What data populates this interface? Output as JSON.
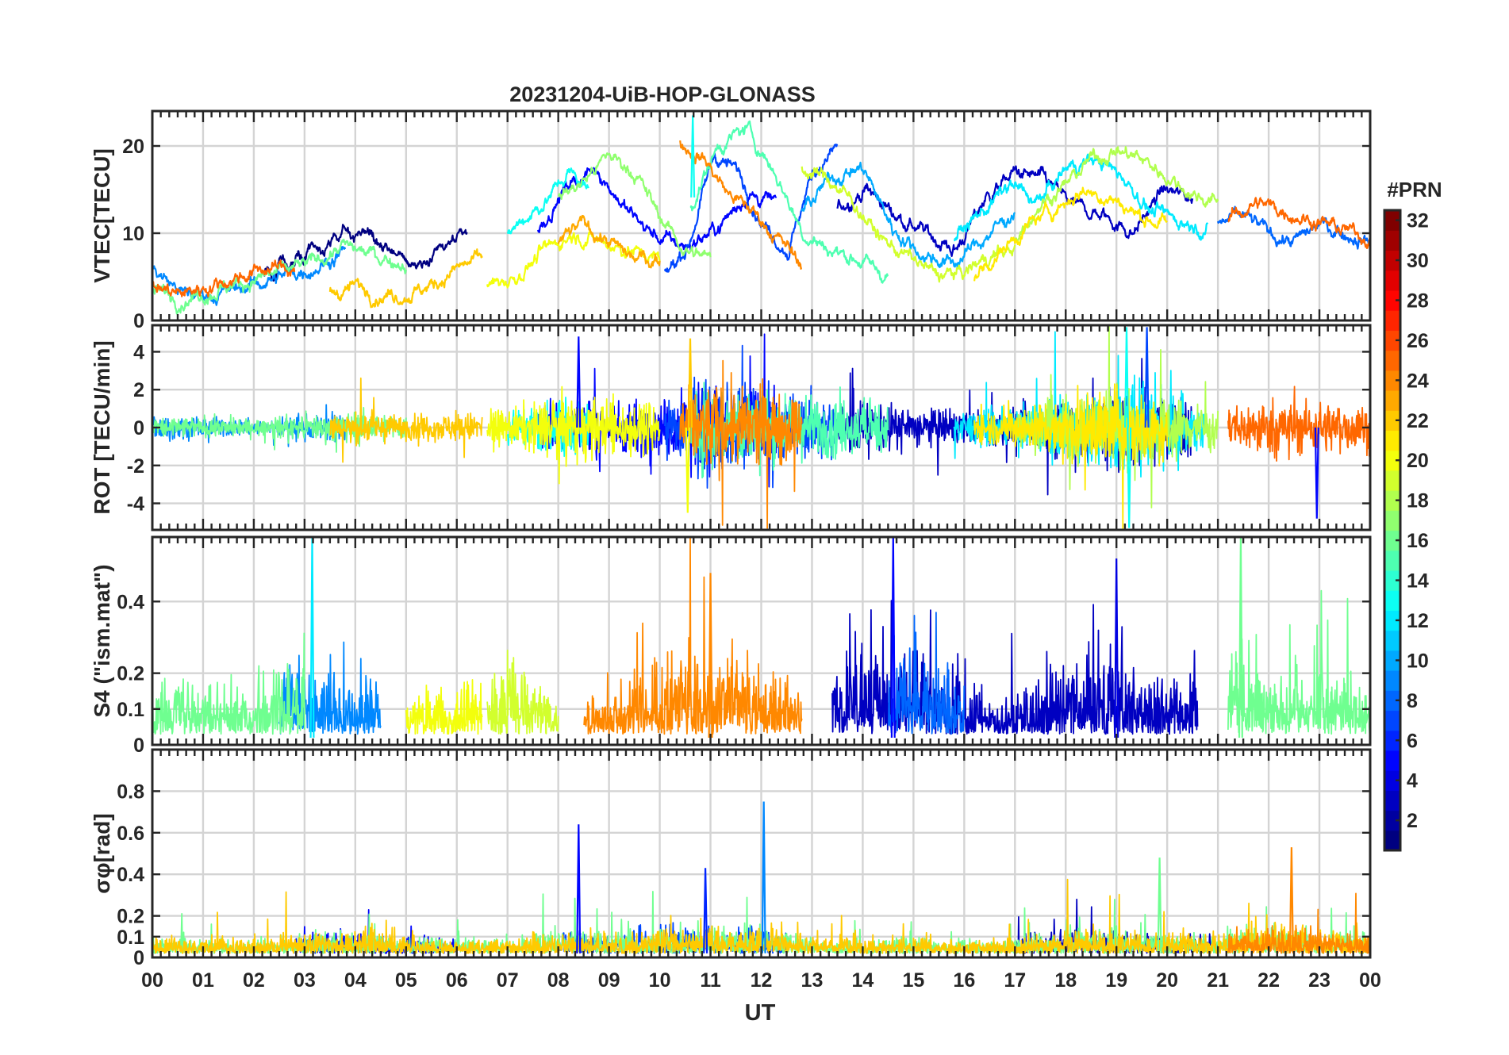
{
  "chart_data": {
    "type": "line",
    "title": "20231204-UiB-HOP-GLONASS",
    "xlabel": "UT",
    "x_ticks": [
      "00",
      "01",
      "02",
      "03",
      "04",
      "05",
      "06",
      "07",
      "08",
      "09",
      "10",
      "11",
      "12",
      "13",
      "14",
      "15",
      "16",
      "17",
      "18",
      "19",
      "20",
      "21",
      "22",
      "23",
      "00"
    ],
    "xlim": [
      0,
      24
    ],
    "grid": true,
    "colorbar": {
      "label": "#PRN",
      "range": [
        1,
        32
      ],
      "ticks": [
        "2",
        "4",
        "6",
        "8",
        "10",
        "12",
        "14",
        "16",
        "18",
        "20",
        "22",
        "24",
        "26",
        "28",
        "30",
        "32"
      ],
      "colormap": "jet",
      "placement": "right"
    },
    "panels": [
      {
        "id": "vtec",
        "ylabel": "VTEC[TECU]",
        "ylim": [
          0,
          24
        ],
        "yticks": [
          {
            "v": 0,
            "label": "0"
          },
          {
            "v": 10,
            "label": "10"
          },
          {
            "v": 20,
            "label": "20"
          }
        ],
        "envelope": {
          "hours": [
            0,
            1,
            2,
            3,
            4,
            5,
            6,
            7,
            8,
            9,
            10,
            11,
            12,
            13,
            14,
            15,
            16,
            17,
            18,
            19,
            20,
            21,
            22,
            23,
            24
          ],
          "mean": [
            4,
            4.5,
            5,
            6.5,
            6,
            6.5,
            8,
            9.5,
            12,
            13,
            12,
            15,
            13,
            12,
            10,
            9,
            10,
            11,
            12,
            14,
            12,
            10.5,
            10,
            9.5,
            9
          ]
        },
        "series": [
          {
            "prn": 1,
            "t0": 2.2,
            "t1": 6.2,
            "offset": 0.5,
            "values": [
              5,
              6,
              7,
              9,
              10,
              7,
              6,
              8,
              9
            ]
          },
          {
            "prn": 3,
            "t0": 13.5,
            "t1": 20.5,
            "offset": 1.0,
            "values": [
              12,
              14,
              11,
              9,
              7,
              13,
              16,
              15,
              12,
              11,
              9,
              14,
              13
            ]
          },
          {
            "prn": 5,
            "t0": 7.6,
            "t1": 12.3,
            "offset": 0.5,
            "values": [
              10,
              15,
              17,
              12,
              9,
              8,
              10,
              14,
              13
            ]
          },
          {
            "prn": 7,
            "t0": 10.1,
            "t1": 13.5,
            "offset": 2.0,
            "values": [
              3,
              7,
              17,
              15,
              9,
              6,
              15,
              18
            ]
          },
          {
            "prn": 8,
            "t0": 21.0,
            "t1": 24.0,
            "offset": 0.0,
            "values": [
              11,
              12,
              10,
              9,
              11,
              10,
              9
            ]
          },
          {
            "prn": 9,
            "t0": 0.0,
            "t1": 3.8,
            "offset": 0.0,
            "values": [
              6,
              3,
              3,
              4,
              5,
              6,
              8
            ]
          },
          {
            "prn": 10,
            "t0": 12.8,
            "t1": 17.0,
            "offset": 0.5,
            "values": [
              12,
              16,
              17,
              10,
              7,
              6,
              9,
              12
            ]
          },
          {
            "prn": 12,
            "t0": 15.8,
            "t1": 20.8,
            "offset": 0.5,
            "values": [
              9,
              12,
              15,
              13,
              17,
              18,
              16,
              12,
              11,
              10
            ]
          },
          {
            "prn": 13,
            "t0": 7.0,
            "t1": 8.6,
            "offset": 0.0,
            "values": [
              10,
              12,
              14,
              17,
              15
            ]
          },
          {
            "prn": 15,
            "t0": 10.6,
            "t1": 14.5,
            "offset": 0.0,
            "values": [
              13,
              20,
              22,
              17,
              10,
              8,
              7,
              5
            ]
          },
          {
            "prn": 16,
            "t0": 0.0,
            "t1": 5.0,
            "offset": 0.5,
            "values": [
              3,
              2,
              3,
              4,
              5,
              6,
              8,
              7,
              6
            ]
          },
          {
            "prn": 17,
            "t0": 8.0,
            "t1": 11.0,
            "offset": 0.0,
            "values": [
              14,
              16,
              19,
              17,
              12,
              8,
              7
            ]
          },
          {
            "prn": 18,
            "t0": 17.0,
            "t1": 21.0,
            "offset": 0.5,
            "values": [
              9,
              13,
              15,
              18,
              19,
              18,
              16,
              14,
              13
            ]
          },
          {
            "prn": 19,
            "t0": 12.8,
            "t1": 17.0,
            "offset": 0.3,
            "values": [
              17,
              16,
              13,
              9,
              7,
              5,
              5,
              7,
              8
            ]
          },
          {
            "prn": 20,
            "t0": 6.6,
            "t1": 10.0,
            "offset": 0.0,
            "values": [
              4,
              5,
              8,
              10,
              9,
              8,
              7
            ]
          },
          {
            "prn": 21,
            "t0": 16.2,
            "t1": 20.0,
            "offset": 0.0,
            "values": [
              5,
              8,
              11,
              13,
              15,
              14,
              12,
              11
            ]
          },
          {
            "prn": 22,
            "t0": 3.5,
            "t1": 6.5,
            "offset": 0.0,
            "values": [
              3,
              4,
              3,
              3,
              4,
              6,
              7
            ]
          },
          {
            "prn": 23,
            "t0": 8.0,
            "t1": 10.0,
            "offset": 0.0,
            "values": [
              9,
              11,
              9,
              7,
              7
            ]
          },
          {
            "prn": 24,
            "t0": 10.4,
            "t1": 12.8,
            "offset": 0.5,
            "values": [
              20,
              18,
              14,
              12,
              9,
              6
            ]
          },
          {
            "prn": 25,
            "t0": 21.2,
            "t1": 24.0,
            "offset": 0.5,
            "values": [
              11,
              13,
              12,
              11,
              10,
              9
            ]
          },
          {
            "prn": 25,
            "t0": 0.0,
            "t1": 2.8,
            "offset": 0.0,
            "values": [
              4,
              3,
              4,
              5,
              6,
              6
            ]
          }
        ]
      },
      {
        "id": "rot",
        "ylabel": "ROT [TECU/min]",
        "ylim": [
          -5.4,
          5.4
        ],
        "yticks": [
          {
            "v": -4,
            "label": "-4"
          },
          {
            "v": -2,
            "label": "-2"
          },
          {
            "v": 0,
            "label": "0"
          },
          {
            "v": 2,
            "label": "2"
          },
          {
            "v": 4,
            "label": "4"
          }
        ],
        "envelope": {
          "hours": [
            0,
            1,
            2,
            3,
            4,
            5,
            6,
            7,
            8,
            9,
            10,
            11,
            12,
            13,
            14,
            15,
            16,
            17,
            18,
            19,
            20,
            21,
            22,
            23,
            24
          ],
          "amplitude": [
            0.6,
            0.5,
            0.4,
            0.6,
            0.8,
            0.6,
            0.7,
            0.9,
            1.5,
            1.4,
            1.3,
            2.2,
            1.8,
            1.6,
            1.3,
            1.0,
            0.8,
            0.9,
            1.6,
            2.2,
            1.6,
            1.0,
            1.4,
            1.3,
            1.1
          ]
        },
        "series": [
          {
            "prn": 3,
            "t0": 13.5,
            "t1": 20.5,
            "offset": 0,
            "values": []
          },
          {
            "prn": 5,
            "t0": 7.6,
            "t1": 12.3,
            "offset": 0,
            "values": []
          },
          {
            "prn": 7,
            "t0": 10.1,
            "t1": 13.5,
            "offset": 0,
            "values": []
          },
          {
            "prn": 9,
            "t0": 0.0,
            "t1": 3.8,
            "offset": 0,
            "values": []
          },
          {
            "prn": 12,
            "t0": 15.8,
            "t1": 20.8,
            "offset": 0,
            "values": []
          },
          {
            "prn": 13,
            "t0": 7.0,
            "t1": 8.6,
            "offset": 0,
            "values": []
          },
          {
            "prn": 15,
            "t0": 10.6,
            "t1": 14.5,
            "offset": 0,
            "values": []
          },
          {
            "prn": 16,
            "t0": 0.0,
            "t1": 5.0,
            "offset": 0,
            "values": []
          },
          {
            "prn": 18,
            "t0": 17.0,
            "t1": 21.0,
            "offset": 0,
            "values": []
          },
          {
            "prn": 20,
            "t0": 6.6,
            "t1": 10.0,
            "offset": 0,
            "values": []
          },
          {
            "prn": 21,
            "t0": 16.2,
            "t1": 20.0,
            "offset": 0,
            "values": []
          },
          {
            "prn": 22,
            "t0": 3.5,
            "t1": 6.5,
            "offset": 0,
            "values": []
          },
          {
            "prn": 24,
            "t0": 10.4,
            "t1": 12.8,
            "offset": 0,
            "values": []
          },
          {
            "prn": 25,
            "t0": 21.2,
            "t1": 24.0,
            "offset": 0,
            "values": []
          }
        ]
      },
      {
        "id": "s4",
        "ylabel": "S4 (\"ism.mat\")",
        "ylim": [
          0,
          0.58
        ],
        "yticks": [
          {
            "v": 0,
            "label": "0"
          },
          {
            "v": 0.1,
            "label": "0.1"
          },
          {
            "v": 0.2,
            "label": "0.2"
          },
          {
            "v": 0.4,
            "label": "0.4"
          }
        ],
        "envelope": {
          "hours": [
            0,
            1,
            2,
            3,
            4,
            5,
            6,
            7,
            8,
            9,
            10,
            11,
            12,
            13,
            14,
            15,
            16,
            17,
            18,
            19,
            20,
            21,
            22,
            23,
            24
          ],
          "mean": [
            0.12,
            0.14,
            0.13,
            0.2,
            0.13,
            0.12,
            0.1,
            0.2,
            0.1,
            0.12,
            0.18,
            0.22,
            0.18,
            0.1,
            0.2,
            0.22,
            0.13,
            0.1,
            0.18,
            0.2,
            0.12,
            0.22,
            0.15,
            0.2,
            0.1
          ]
        },
        "series": [
          {
            "prn": 3,
            "t0": 13.4,
            "t1": 20.6,
            "offset": 0,
            "values": []
          },
          {
            "prn": 9,
            "t0": 2.5,
            "t1": 4.5,
            "offset": 0,
            "values": []
          },
          {
            "prn": 16,
            "t0": 0.0,
            "t1": 3.0,
            "offset": 0,
            "values": []
          },
          {
            "prn": 16,
            "t0": 21.2,
            "t1": 24.0,
            "offset": 0,
            "values": []
          },
          {
            "prn": 19,
            "t0": 6.6,
            "t1": 8.0,
            "offset": 0,
            "values": []
          },
          {
            "prn": 20,
            "t0": 5.0,
            "t1": 6.5,
            "offset": 0,
            "values": []
          },
          {
            "prn": 24,
            "t0": 8.5,
            "t1": 12.8,
            "offset": 0,
            "values": []
          },
          {
            "prn": 8,
            "t0": 14.5,
            "t1": 16.0,
            "offset": 0,
            "values": []
          }
        ]
      },
      {
        "id": "sigma",
        "ylabel": "σφ[rad]",
        "ylim": [
          0,
          1.0
        ],
        "yticks": [
          {
            "v": 0,
            "label": "0"
          },
          {
            "v": 0.1,
            "label": "0.1"
          },
          {
            "v": 0.2,
            "label": "0.2"
          },
          {
            "v": 0.4,
            "label": "0.4"
          },
          {
            "v": 0.6,
            "label": "0.6"
          },
          {
            "v": 0.8,
            "label": "0.8"
          }
        ],
        "envelope": {
          "hours": [
            0,
            1,
            2,
            3,
            4,
            5,
            6,
            7,
            8,
            9,
            10,
            11,
            12,
            13,
            14,
            15,
            16,
            17,
            18,
            19,
            20,
            21,
            22,
            23,
            24
          ],
          "mean": [
            0.08,
            0.06,
            0.06,
            0.08,
            0.1,
            0.07,
            0.06,
            0.06,
            0.1,
            0.08,
            0.1,
            0.12,
            0.12,
            0.07,
            0.06,
            0.07,
            0.06,
            0.06,
            0.1,
            0.1,
            0.08,
            0.08,
            0.12,
            0.1,
            0.08
          ]
        },
        "series": [
          {
            "prn": 3,
            "t0": 17.0,
            "t1": 21.0,
            "offset": 0,
            "values": []
          },
          {
            "prn": 5,
            "t0": 2.8,
            "t1": 6.0,
            "offset": 0,
            "values": []
          },
          {
            "prn": 7,
            "t0": 8.0,
            "t1": 12.5,
            "offset": 0,
            "values": []
          },
          {
            "prn": 16,
            "t0": 0.0,
            "t1": 24.0,
            "offset": 0,
            "values": []
          },
          {
            "prn": 22,
            "t0": 0.0,
            "t1": 24.0,
            "offset": 0,
            "values": []
          },
          {
            "prn": 24,
            "t0": 21.2,
            "t1": 24.0,
            "offset": 0,
            "values": []
          }
        ]
      }
    ],
    "annotated_spikes": [
      {
        "panel": "vtec",
        "prn": 13,
        "t": 10.65,
        "v": 23.5
      },
      {
        "panel": "rot",
        "prn": 5,
        "t": 8.4,
        "v": 4.8
      },
      {
        "panel": "rot",
        "prn": 22,
        "t": 10.6,
        "v": 4.7
      },
      {
        "panel": "rot",
        "prn": 13,
        "t": 19.2,
        "v": 5.3
      },
      {
        "panel": "rot",
        "prn": 7,
        "t": 19.6,
        "v": 5.3
      },
      {
        "panel": "rot",
        "prn": 13,
        "t": 19.25,
        "v": -5.3
      },
      {
        "panel": "rot",
        "prn": 20,
        "t": 10.55,
        "v": -4.5
      },
      {
        "panel": "rot",
        "prn": 5,
        "t": 22.95,
        "v": -4.8
      },
      {
        "panel": "s4",
        "prn": 12,
        "t": 3.15,
        "v": 0.58
      },
      {
        "panel": "s4",
        "prn": 5,
        "t": 14.6,
        "v": 0.58
      },
      {
        "panel": "s4",
        "prn": 16,
        "t": 21.45,
        "v": 0.58
      },
      {
        "panel": "s4",
        "prn": 4,
        "t": 19.0,
        "v": 0.52
      },
      {
        "panel": "s4",
        "prn": 24,
        "t": 11.0,
        "v": 0.48
      },
      {
        "panel": "sigma",
        "prn": 9,
        "t": 12.05,
        "v": 0.75
      },
      {
        "panel": "sigma",
        "prn": 5,
        "t": 8.4,
        "v": 0.64
      },
      {
        "panel": "sigma",
        "prn": 24,
        "t": 22.45,
        "v": 0.53
      },
      {
        "panel": "sigma",
        "prn": 16,
        "t": 19.85,
        "v": 0.48
      },
      {
        "panel": "sigma",
        "prn": 6,
        "t": 10.9,
        "v": 0.43
      }
    ]
  }
}
